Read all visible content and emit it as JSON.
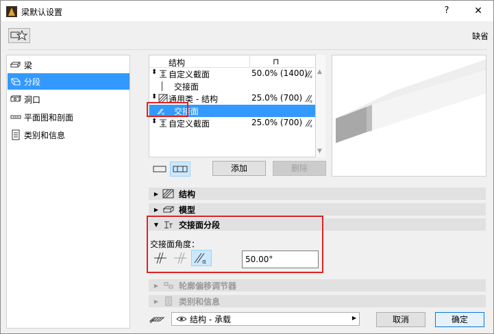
{
  "window": {
    "title": "梁默认设置",
    "help": "?",
    "close": "✕"
  },
  "toolbar": {
    "default_label": "缺省"
  },
  "nav": {
    "items": [
      {
        "label": "梁",
        "icon": "beam-icon"
      },
      {
        "label": "分段",
        "icon": "segment-icon",
        "selected": true
      },
      {
        "label": "洞口",
        "icon": "opening-icon"
      },
      {
        "label": "平面图和剖面",
        "icon": "floorplan-section-icon"
      },
      {
        "label": "类别和信息",
        "icon": "classification-icon"
      }
    ]
  },
  "segments": {
    "header": {
      "structure": "结构",
      "width_symbol": "⊓"
    },
    "rows": [
      {
        "arrows": "⬍",
        "name": "自定义截面",
        "value": "50.0% (1400)"
      },
      {
        "name": "交接面"
      },
      {
        "arrows": "⬍",
        "name": "通用类 - 结构",
        "value": "25.0% (700)"
      },
      {
        "name": "交接面",
        "selected": true
      },
      {
        "arrows": "⬍",
        "name": "自定义截面",
        "value": "25.0% (700)"
      }
    ]
  },
  "buttons": {
    "add": "添加",
    "delete": "删除",
    "cancel": "取消",
    "ok": "确定"
  },
  "panels": {
    "structure": "结构",
    "model": "模型",
    "junction": "交接面分段",
    "offset": "轮廓偏移调节器",
    "classification": "类别和信息"
  },
  "junction": {
    "angle_label": "交接面角度：",
    "angle_value": "50.00°"
  },
  "layer": {
    "value": "结构 - 承载"
  },
  "colors": {
    "selection": "#3399ff",
    "highlight_box": "#e02020"
  }
}
